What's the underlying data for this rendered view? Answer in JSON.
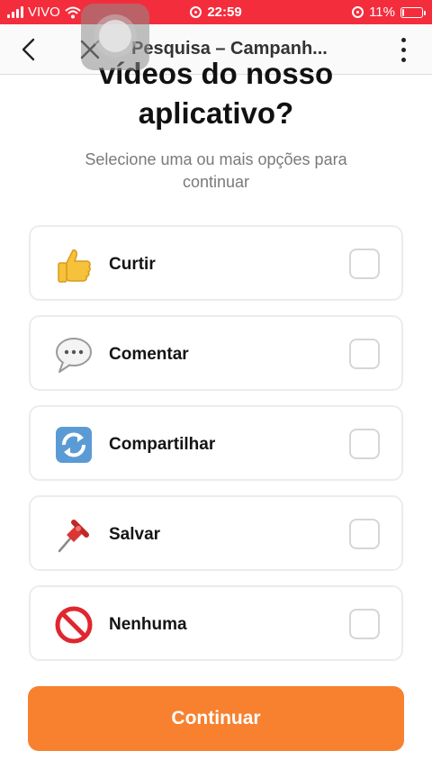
{
  "status_bar": {
    "carrier": "VIVO",
    "time": "22:59",
    "battery_percent": "11%",
    "battery_level": 0.11,
    "background_color": "#f42d3d"
  },
  "nav": {
    "title": "Pesquisa – Campanh...",
    "back_icon": "chevron-left-icon",
    "close_icon": "close-icon",
    "more_icon": "more-vertical-icon"
  },
  "question": {
    "title_line1": "vídeos do nosso",
    "title_line2": "aplicativo?",
    "subtitle": "Selecione uma ou mais opções para continuar"
  },
  "options": [
    {
      "label": "Curtir",
      "icon": "thumbs-up-icon",
      "checked": false
    },
    {
      "label": "Comentar",
      "icon": "speech-bubble-icon",
      "checked": false
    },
    {
      "label": "Compartilhar",
      "icon": "repeat-arrows-icon",
      "checked": false
    },
    {
      "label": "Salvar",
      "icon": "pushpin-icon",
      "checked": false
    },
    {
      "label": "Nenhuma",
      "icon": "no-entry-icon",
      "checked": false
    }
  ],
  "continue_button": {
    "label": "Continuar",
    "color": "#f7812f"
  }
}
